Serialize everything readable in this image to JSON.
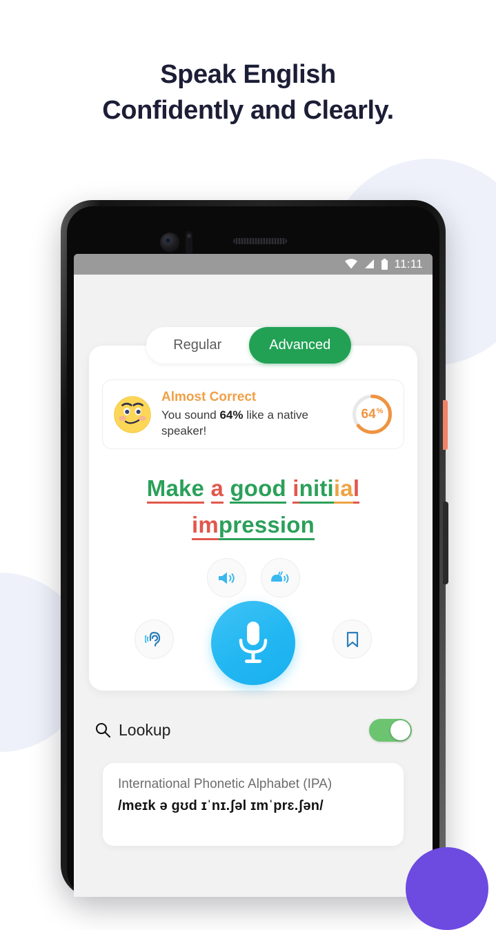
{
  "headline": {
    "line1": "Speak English",
    "line2": "Confidently and Clearly."
  },
  "status_bar": {
    "time": "11:11",
    "icons": [
      "wifi-icon",
      "cellular-signal-icon",
      "battery-icon"
    ]
  },
  "mode_toggle": {
    "regular_label": "Regular",
    "advanced_label": "Advanced",
    "selected": "Advanced"
  },
  "feedback": {
    "emoji": "smirking-face-emoji",
    "title": "Almost Correct",
    "body_prefix": "You sound ",
    "body_value": "64%",
    "body_suffix": " like a native speaker!",
    "score": 64,
    "score_text": "64",
    "score_unit": "%",
    "accent_color": "#ef9440",
    "track_color": "#e8e8e8"
  },
  "phrase": {
    "full_text": "Make a good initial impression",
    "line1": [
      {
        "text": "Make",
        "color": "green",
        "underline": "red"
      },
      {
        "text": "a",
        "color": "red",
        "underline": "red"
      },
      {
        "text": "good",
        "color": "green",
        "underline": "green"
      },
      {
        "text": "i",
        "color": "red",
        "underline": "red"
      },
      {
        "text": "niti",
        "color": "green",
        "underline": "green"
      },
      {
        "text": "ia",
        "color": "orange",
        "underline": "orange"
      },
      {
        "text": "l",
        "color": "red",
        "underline": "red"
      }
    ],
    "line2": [
      {
        "text": "im",
        "color": "red",
        "underline": "red"
      },
      {
        "text": "pression",
        "color": "green",
        "underline": "green"
      }
    ],
    "colors": {
      "green": "#2ba05a",
      "red": "#e2574c",
      "orange": "#eda343"
    }
  },
  "playback": {
    "normal_speed": "speaker-icon",
    "slow_speed": "snail-speaker-icon"
  },
  "controls": {
    "listen": "ear-listen-icon",
    "record": "microphone-icon",
    "bookmark": "bookmark-icon",
    "mic_color": "#22b7f2"
  },
  "lookup": {
    "icon": "search-icon",
    "label": "Lookup",
    "enabled": true,
    "switch_color": "#6cc471"
  },
  "ipa": {
    "title": "International Phonetic Alphabet (IPA)",
    "transcription": "/meɪk ə gʊd ɪˈnɪ.ʃəl ɪmˈprɛ.ʃən/"
  }
}
